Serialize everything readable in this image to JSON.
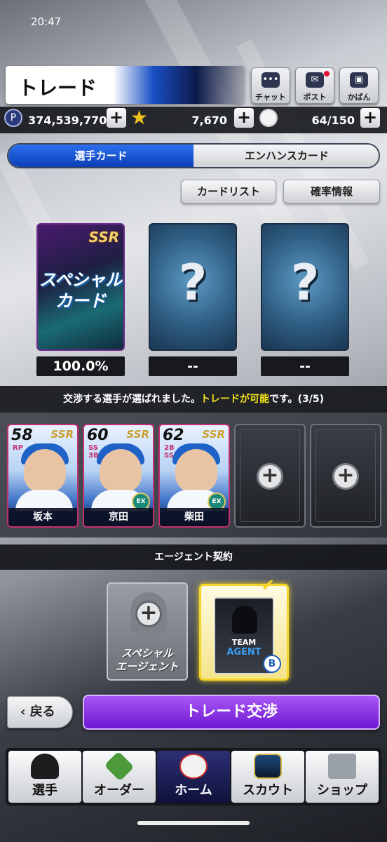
{
  "status_bar": {
    "time": "20:47"
  },
  "header": {
    "title": "トレード"
  },
  "top_buttons": [
    {
      "label": "チャット",
      "icon": "chat-icon"
    },
    {
      "label": "ポスト",
      "icon": "mail-icon"
    },
    {
      "label": "かばん",
      "icon": "bag-icon"
    }
  ],
  "currency": {
    "points": "374,539,770",
    "stars": "7,670",
    "balls": "64/150",
    "plus": "+"
  },
  "tabs": {
    "active": "選手カード",
    "inactive": "エンハンスカード"
  },
  "sub_buttons": {
    "card_list": "カードリスト",
    "probability": "確率情報"
  },
  "reward_cards": [
    {
      "rarity": "SSR",
      "label_line1": "スペシャル",
      "label_line2": "カード",
      "percent": "100.0%"
    },
    {
      "label": "?",
      "percent": "-- "
    },
    {
      "label": "?",
      "percent": "--"
    }
  ],
  "status_message": {
    "prefix": "交渉する選手が選ばれました。",
    "highlight": "トレードが可能",
    "suffix": "です。(3/5)"
  },
  "players": [
    {
      "overall": "58",
      "position": "RP",
      "rarity": "SSR",
      "name": "坂本"
    },
    {
      "overall": "60",
      "position": "SS 3B",
      "rarity": "SSR",
      "name": "京田",
      "badge": "EX"
    },
    {
      "overall": "62",
      "position": "2B SS",
      "rarity": "SSR",
      "name": "柴田",
      "badge": "EX"
    }
  ],
  "empty_slot_plus": "+",
  "agent_section": {
    "title": "エージェント契約"
  },
  "agents": [
    {
      "label_line1": "スペシャル",
      "label_line2": "エージェント"
    },
    {
      "line1": "TEAM",
      "line2": "AGENT",
      "team_badge": "B"
    }
  ],
  "actions": {
    "back": "戻る",
    "trade": "トレード交渉"
  },
  "bottom_nav": [
    {
      "label": "選手",
      "icon": "cap-icon"
    },
    {
      "label": "オーダー",
      "icon": "field-icon"
    },
    {
      "label": "ホーム",
      "icon": "baseball-icon"
    },
    {
      "label": "スカウト",
      "icon": "cards-icon"
    },
    {
      "label": "ショップ",
      "icon": "cart-icon"
    }
  ],
  "colors": {
    "accent_blue": "#1a4fc5",
    "trade_purple": "#8a2be2",
    "highlight_yellow": "#f6e41a",
    "ssr_border": "#c2306f"
  }
}
